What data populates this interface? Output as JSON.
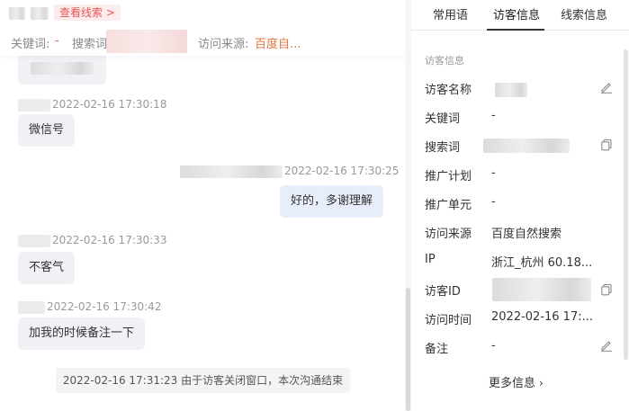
{
  "header": {
    "view_clue": "查看线索 >",
    "keyword_label": "关键词:",
    "keyword_value": "-",
    "search_label": "搜索词",
    "source_label": "访问来源:",
    "source_value": "百度自..."
  },
  "messages": [
    {
      "time": "2022-02-16 17:30:18",
      "text": "微信号",
      "side": "in"
    },
    {
      "time": "2022-02-16 17:30:25",
      "text": "好的，多谢理解",
      "side": "out"
    },
    {
      "time": "2022-02-16 17:30:33",
      "text": "不客气",
      "side": "in"
    },
    {
      "time": "2022-02-16 17:30:42",
      "text": "加我的时候备注一下",
      "side": "in"
    }
  ],
  "system_note": "2022-02-16 17:31:23 由于访客关闭窗口，本次沟通结束",
  "tabs": [
    {
      "label": "常用语"
    },
    {
      "label": "访客信息"
    },
    {
      "label": "线索信息"
    }
  ],
  "visitor": {
    "section_title": "访客信息",
    "rows": [
      {
        "label": "访客名称",
        "value": ""
      },
      {
        "label": "关键词",
        "value": "-"
      },
      {
        "label": "搜索词",
        "value": ""
      },
      {
        "label": "推广计划",
        "value": "-"
      },
      {
        "label": "推广单元",
        "value": "-"
      },
      {
        "label": "访问来源",
        "value": "百度自然搜索"
      },
      {
        "label": "IP",
        "value": "浙江_杭州 60.18..."
      },
      {
        "label": "访客ID",
        "value": ""
      },
      {
        "label": "访问时间",
        "value": "2022-02-16 17:..."
      },
      {
        "label": "备注",
        "value": "-"
      }
    ],
    "more_info": "更多信息"
  },
  "icons": {
    "edit": "edit-icon",
    "copy": "copy-icon",
    "chevron": "chevron-right-icon"
  },
  "colors": {
    "accent_red": "#e85555",
    "source_orange": "#e0743c",
    "bubble_in": "#f0f1f5",
    "bubble_out": "#e8edfb"
  }
}
